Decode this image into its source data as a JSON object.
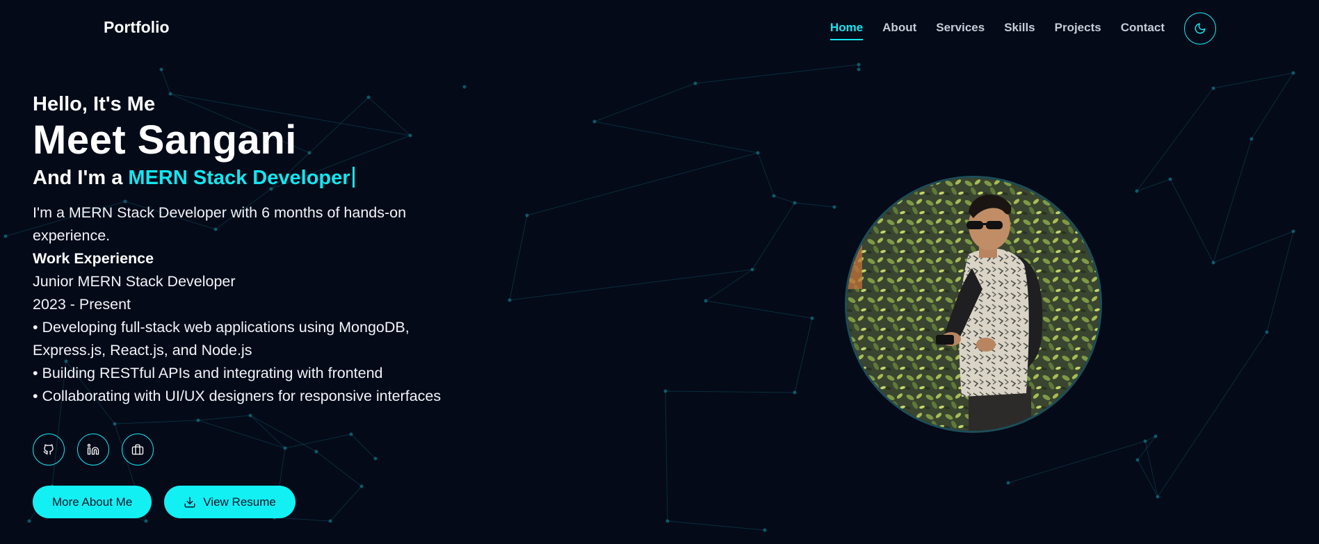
{
  "nav": {
    "brand": "Portfolio",
    "items": [
      {
        "label": "Home",
        "active": true
      },
      {
        "label": "About",
        "active": false
      },
      {
        "label": "Services",
        "active": false
      },
      {
        "label": "Skills",
        "active": false
      },
      {
        "label": "Projects",
        "active": false
      },
      {
        "label": "Contact",
        "active": false
      }
    ],
    "theme_toggle_icon": "moon-icon"
  },
  "hero": {
    "greeting": "Hello, It's Me",
    "name": "Meet Sangani",
    "role_prefix": "And I'm a",
    "role": "MERN Stack Developer",
    "intro": "I'm a MERN Stack Developer with 6 months of hands-on experience.",
    "work_heading": "Work Experience",
    "job_title": "Junior MERN Stack Developer",
    "job_period": "2023 - Present",
    "bullets": [
      "• Developing full-stack web applications using MongoDB, Express.js, React.js, and Node.js",
      "• Building RESTful APIs and integrating with frontend",
      "• Collaborating with UI/UX designers for responsive interfaces"
    ]
  },
  "socials": [
    {
      "icon": "github-icon"
    },
    {
      "icon": "linkedin-icon"
    },
    {
      "icon": "briefcase-icon"
    }
  ],
  "buttons": {
    "more_about": "More About Me",
    "view_resume": "View Resume",
    "view_resume_icon": "download-icon"
  },
  "colors": {
    "background": "#040a18",
    "accent": "#12e6f0",
    "text": "#ffffff"
  }
}
